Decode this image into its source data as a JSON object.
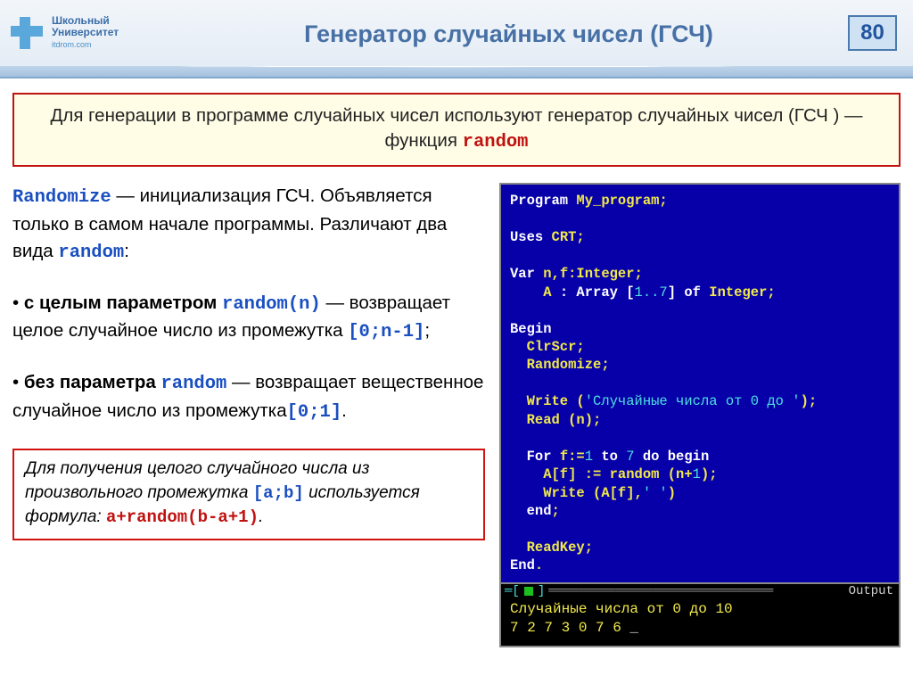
{
  "header": {
    "logo_line1": "Школьный",
    "logo_line2": "Университет",
    "logo_sub": "itdrom.com",
    "title": "Генератор случайных чисел  (ГСЧ)",
    "page_number": "80"
  },
  "intro": {
    "text_before": "Для генерации в программе случайных чисел используют генератор случайных чисел (ГСЧ ) — функция ",
    "code": "random"
  },
  "left": {
    "p1_head": "Randomize",
    "p1_mid": "  —   инициализация ГСЧ. Объявляется только в самом начале программы. Различают два вида ",
    "p1_code": "random",
    "p1_tail": ":",
    "p2_bullet": "• ",
    "p2_bold": "с целым параметром ",
    "p2_code": "random(n)",
    "p2_rest": " — возвращает целое случайное число из промежутка ",
    "p2_range": "[0;n-1]",
    "p2_semi": ";",
    "p3_bullet": "• ",
    "p3_bold": "без параметра ",
    "p3_code": "random",
    "p3_rest": " — возвращает вещественное случайное число из промежутка",
    "p3_range": "[0;1]",
    "p3_dot": ".",
    "note_t1": "Для получения целого случайного числа из произвольного промежутка ",
    "note_range": "[a;b]",
    "note_t2": " используется формула: ",
    "note_formula": "a+random(b-a+1)",
    "note_dot": "."
  },
  "code": {
    "l1a": "Program ",
    "l1b": "My_program;",
    "l2a": "Uses ",
    "l2b": "CRT;",
    "l3a": "Var ",
    "l3b": "n,f:Integer;",
    "l4a": "    A ",
    "l4b": ": Array [",
    "l4c": "1..7",
    "l4d": "] ",
    "l4e": "of",
    "l4f": " Integer;",
    "l5": "Begin",
    "l6": "  ClrScr;",
    "l7": "  Randomize;",
    "l8a": "  Write (",
    "l8b": "'Случайные числа от 0 до '",
    "l8c": ");",
    "l9": "  Read (n);",
    "l10a": "  For ",
    "l10b": "f:=",
    "l10c": "1 ",
    "l10d": "to ",
    "l10e": "7 ",
    "l10f": "do begin",
    "l11a": "    A[f] := random (n+",
    "l11b": "1",
    "l11c": ");",
    "l12a": "    Write (A[f],",
    "l12b": "' '",
    "l12c": ")",
    "l13a": "  end",
    "l13b": ";",
    "l14": "  ReadKey;",
    "l15a": "End",
    "l15b": "."
  },
  "output": {
    "label": "Output",
    "dashes": "══════════════════════════════",
    "line1": "Случайные числа от 0 до 10",
    "line2": "7 2 7 3 0 7 6 ",
    "cursor": "_"
  }
}
